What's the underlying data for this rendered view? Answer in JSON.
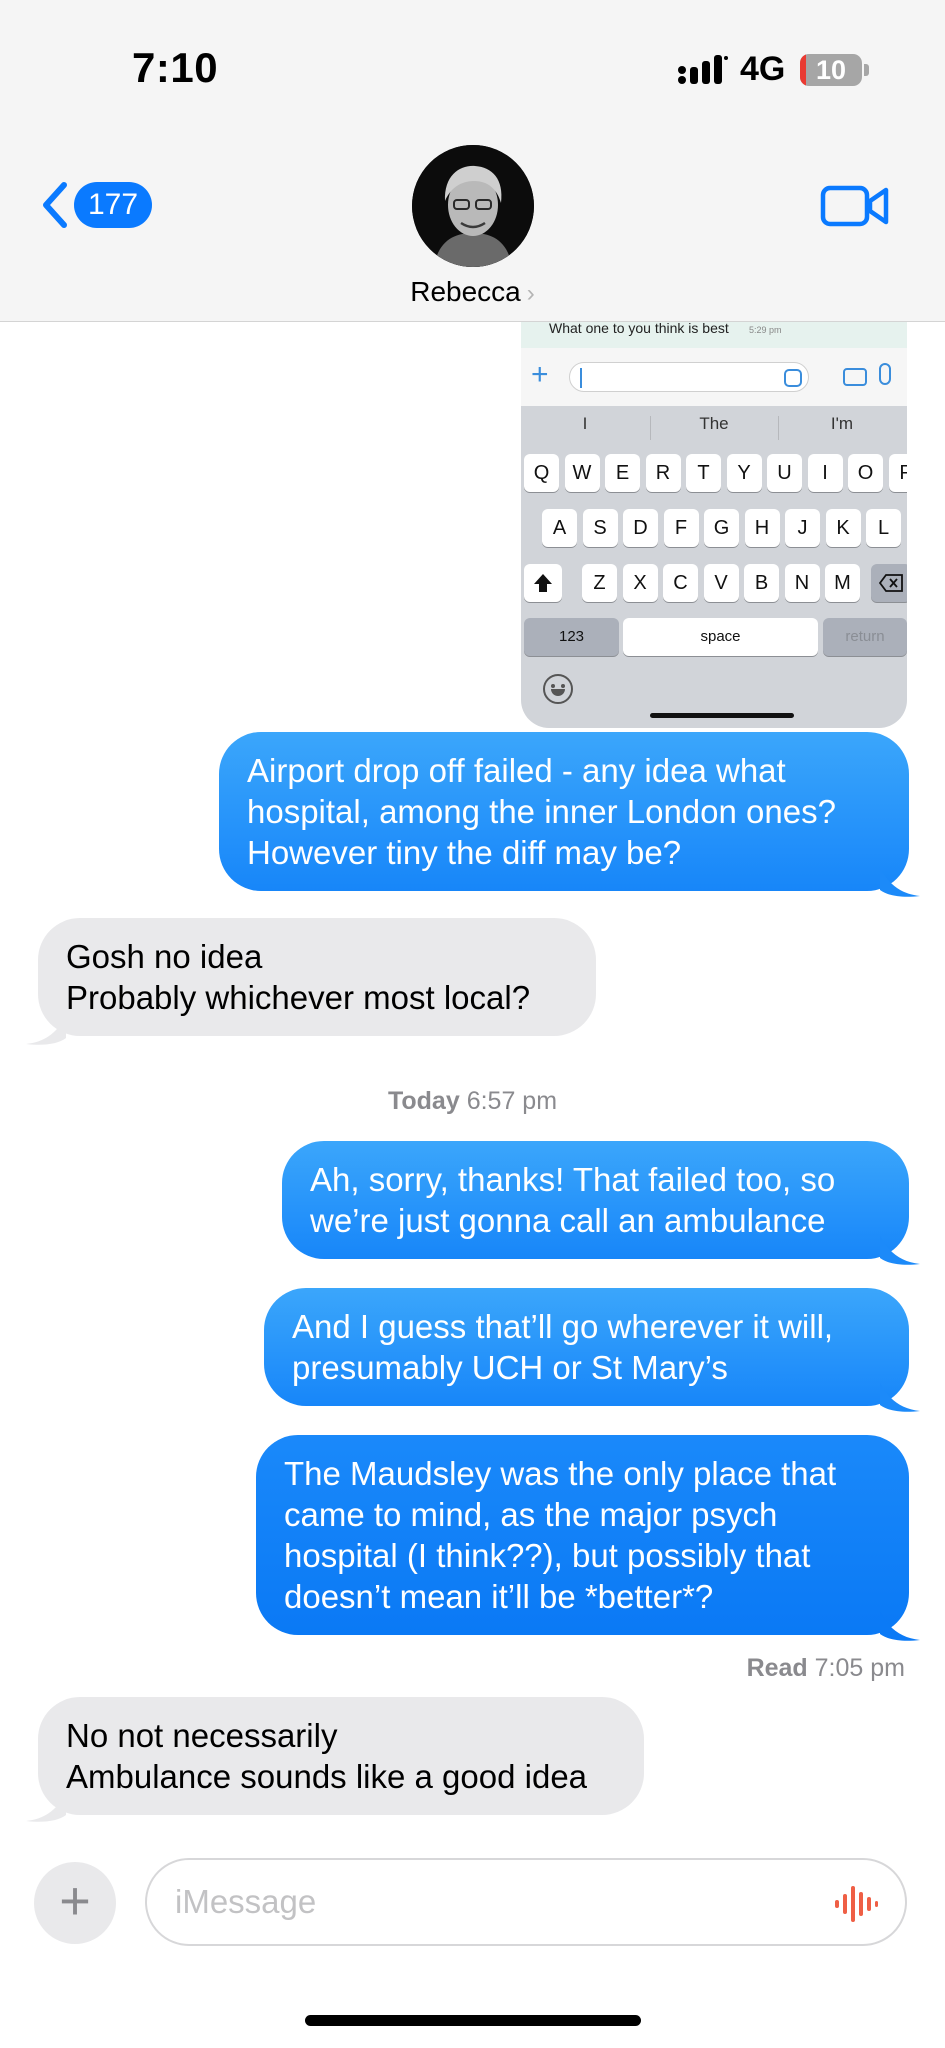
{
  "status_bar": {
    "time": "7:10",
    "network": "4G",
    "battery_percent": "10",
    "battery_level": 0.1
  },
  "header": {
    "unread_count": "177",
    "contact_name": "Rebecca",
    "chevron": "›",
    "video_icon": "video-camera-icon",
    "back_icon": "chevron-left-icon"
  },
  "attachment": {
    "top_message": "What one to you think is best",
    "top_time": "5:29 pm",
    "suggestions": [
      "I",
      "The",
      "I'm"
    ],
    "row1": [
      "Q",
      "W",
      "E",
      "R",
      "T",
      "Y",
      "U",
      "I",
      "O",
      "P"
    ],
    "row2": [
      "A",
      "S",
      "D",
      "F",
      "G",
      "H",
      "J",
      "K",
      "L"
    ],
    "row3": [
      "Z",
      "X",
      "C",
      "V",
      "B",
      "N",
      "M"
    ],
    "key_123": "123",
    "key_space": "space",
    "key_return": "return"
  },
  "messages": [
    {
      "id": "m1",
      "direction": "sent",
      "text": "Airport drop off failed - any idea what\nhospital, among the inner London ones?\nHowever tiny the diff may be?"
    },
    {
      "id": "m2",
      "direction": "received",
      "text": "Gosh no idea\nProbably whichever most local?"
    },
    {
      "id": "m3",
      "direction": "sent",
      "text": "Ah, sorry, thanks! That failed too, so\nwe’re just gonna call an ambulance"
    },
    {
      "id": "m4",
      "direction": "sent",
      "text": "And I guess that’ll go wherever it will,\npresumably UCH or St Mary’s"
    },
    {
      "id": "m5",
      "direction": "sent",
      "text": "The Maudsley was the only place that\ncame to mind, as the major psych\nhospital (I think??), but possibly that\ndoesn’t mean it’ll be *better*?"
    },
    {
      "id": "m6",
      "direction": "received",
      "text": "No not necessarily\nAmbulance sounds like a good idea"
    }
  ],
  "timestamp": {
    "day": "Today",
    "time": "6:57 pm"
  },
  "receipt": {
    "label": "Read",
    "time": "7:05 pm"
  },
  "compose": {
    "placeholder": "iMessage",
    "add_icon": "plus-icon",
    "audio_icon": "waveform-icon"
  },
  "colors": {
    "accent": "#0a7aff",
    "sent_bubble": "#1e8cfa",
    "received_bubble": "#e9e9eb",
    "battery_low": "#ea3a32",
    "waveform": "#ef5f45"
  }
}
